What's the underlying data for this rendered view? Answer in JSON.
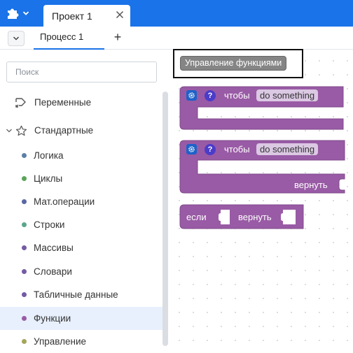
{
  "topbar": {
    "project_tab_label": "Проект 1",
    "plugin_icon": "puzzle-icon"
  },
  "tabs": {
    "process_tab_label": "Процесс 1",
    "add_label": "+"
  },
  "sidebar": {
    "search_placeholder": "Поиск",
    "items": [
      {
        "label": "Переменные",
        "kind": "icon"
      },
      {
        "label": "Стандартные",
        "kind": "expander"
      },
      {
        "label": "Логика",
        "color": "#5b80a5"
      },
      {
        "label": "Циклы",
        "color": "#5ba55b"
      },
      {
        "label": "Мат.операции",
        "color": "#5b67a5"
      },
      {
        "label": "Строки",
        "color": "#5ba58c"
      },
      {
        "label": "Массивы",
        "color": "#745ba5"
      },
      {
        "label": "Словари",
        "color": "#745ba5"
      },
      {
        "label": "Табличные данные",
        "color": "#745ba5"
      },
      {
        "label": "Функции",
        "color": "#995ba5"
      },
      {
        "label": "Управление",
        "color": "#a5a55b"
      }
    ],
    "active_item": "Функции"
  },
  "workspace": {
    "category_label": "Управление функциями",
    "block_color": "#995ba5",
    "blocks": [
      {
        "type": "procedure-noreturn",
        "keyword": "чтобы",
        "name": "do something"
      },
      {
        "type": "procedure-return",
        "keyword": "чтобы",
        "name": "do something",
        "return_label": "вернуть"
      },
      {
        "type": "if-return",
        "if_label": "если",
        "return_label": "вернуть"
      }
    ]
  }
}
